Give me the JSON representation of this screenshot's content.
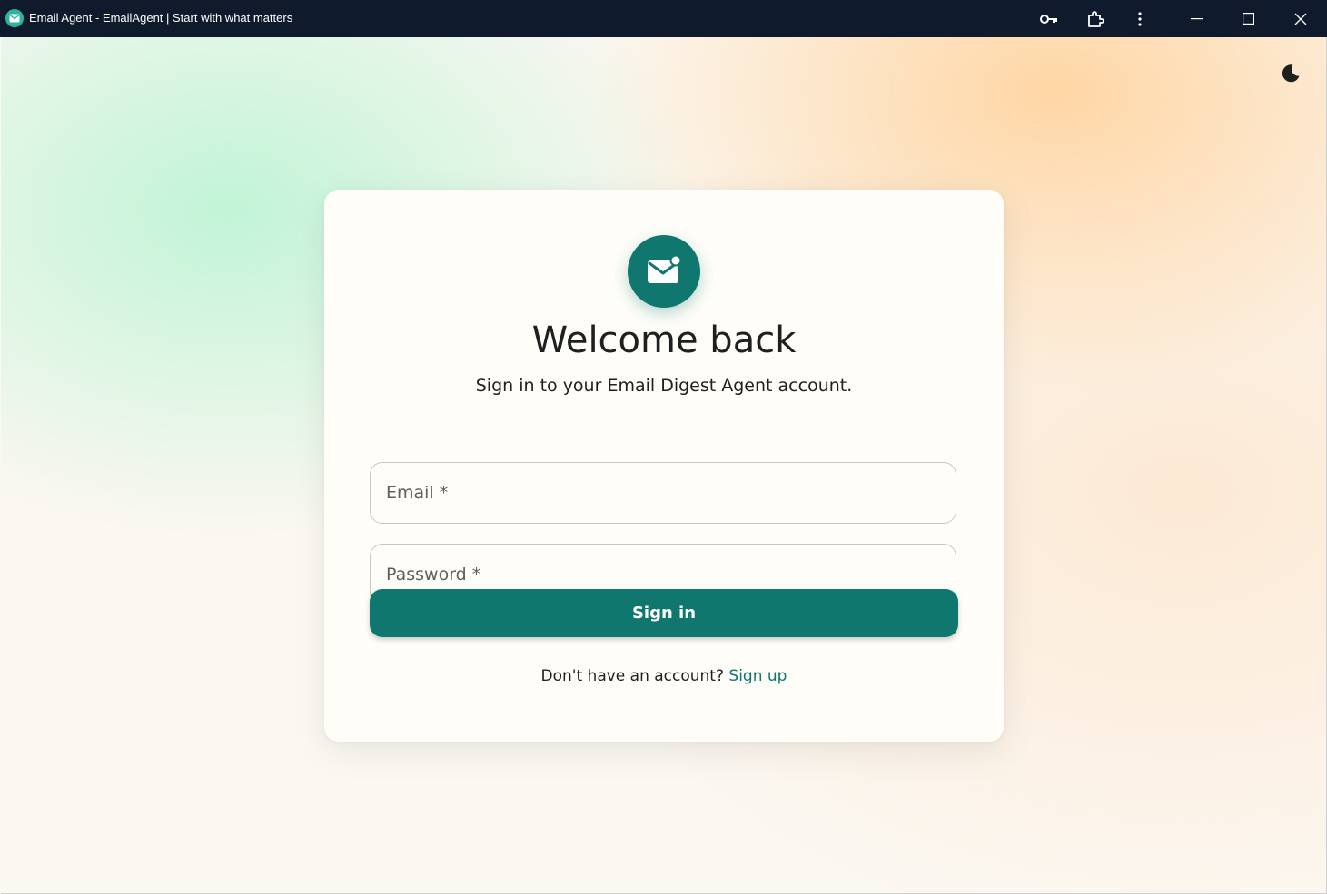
{
  "window": {
    "title": "Email Agent - EmailAgent | Start with what matters",
    "app_icon": "mail-icon",
    "controls": [
      "key-icon",
      "extension-icon",
      "more-vert-icon",
      "minimize-icon",
      "maximize-icon",
      "close-icon"
    ]
  },
  "theme_toggle": {
    "icon": "moon-icon"
  },
  "login": {
    "logo_icon": "mail-notification-icon",
    "title": "Welcome back",
    "subtitle": "Sign in to your Email Digest Agent account.",
    "email_placeholder": "Email *",
    "password_placeholder": "Password *",
    "submit_label": "Sign in",
    "signup_prompt": "Don't have an account?",
    "signup_link": "Sign up"
  },
  "colors": {
    "titlebar": "#0f1b2d",
    "primary": "#0f776d",
    "card": "#fefdf8",
    "text": "#1f1f1f"
  }
}
